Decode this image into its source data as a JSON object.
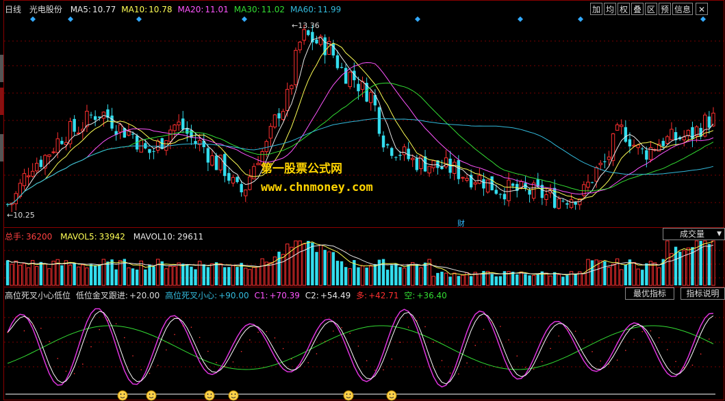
{
  "main_panel": {
    "period": "日线",
    "stock_name": "光电股份",
    "ma": [
      {
        "label": "MA5:",
        "value": "10.77",
        "color": "#e8e8e8"
      },
      {
        "label": "MA10:",
        "value": "10.78",
        "color": "#ffff55"
      },
      {
        "label": "MA20:",
        "value": "11.01",
        "color": "#ff55ff"
      },
      {
        "label": "MA30:",
        "value": "11.02",
        "color": "#33dd33"
      },
      {
        "label": "MA60:",
        "value": "11.99",
        "color": "#33bbdd"
      }
    ],
    "high_label": "13.36",
    "low_label": "10.25",
    "finance_marker": "财",
    "toolbar": [
      "加",
      "均",
      "权",
      "叠",
      "区",
      "预",
      "信息"
    ],
    "watermark_title": "第一股票公式网",
    "watermark_url": "www.chnmoney.com"
  },
  "volume_panel": {
    "total_label": "总手:",
    "total_value": "36200",
    "mavol5_label": "MAVOL5:",
    "mavol5_value": "33942",
    "mavol10_label": "MAVOL10:",
    "mavol10_value": "29611",
    "selector": "成交量"
  },
  "indicator_panel": {
    "name": "高位死叉小心低位",
    "line1_label": "低位金叉跟进:",
    "line1_value": "+20.00",
    "line2_label": "高位死叉小心:",
    "line2_value": "+90.00",
    "c1_label": "C1:",
    "c1_value": "+70.39",
    "c2_label": "C2:",
    "c2_value": "+54.49",
    "duo_label": "多:",
    "duo_value": "+42.71",
    "kong_label": "空:",
    "kong_value": "+36.40",
    "best_button": "最优指标",
    "help_button": "指标说明"
  },
  "colors": {
    "up": "#ff3030",
    "down": "#33ddee",
    "grid": "#7a0000",
    "ma5": "#e8e8e8",
    "ma10": "#ffff55",
    "ma20": "#ff55ff",
    "ma30": "#33dd33",
    "ma60": "#33bbdd"
  },
  "chart_data": {
    "type": "candlestick",
    "price_range": [
      10.25,
      13.36
    ],
    "high_value": 13.36,
    "low_value": 10.25,
    "ma_last": {
      "MA5": 10.77,
      "MA10": 10.78,
      "MA20": 11.01,
      "MA30": 11.02,
      "MA60": 11.99
    },
    "volume_last": 36200,
    "mavol5_last": 33942,
    "mavol10_last": 29611,
    "indicator_last": {
      "C1": 70.39,
      "C2": 54.49,
      "多": 42.71,
      "空": 36.4
    },
    "indicator_levels": [
      20.0,
      90.0
    ],
    "candle_count": 170
  }
}
